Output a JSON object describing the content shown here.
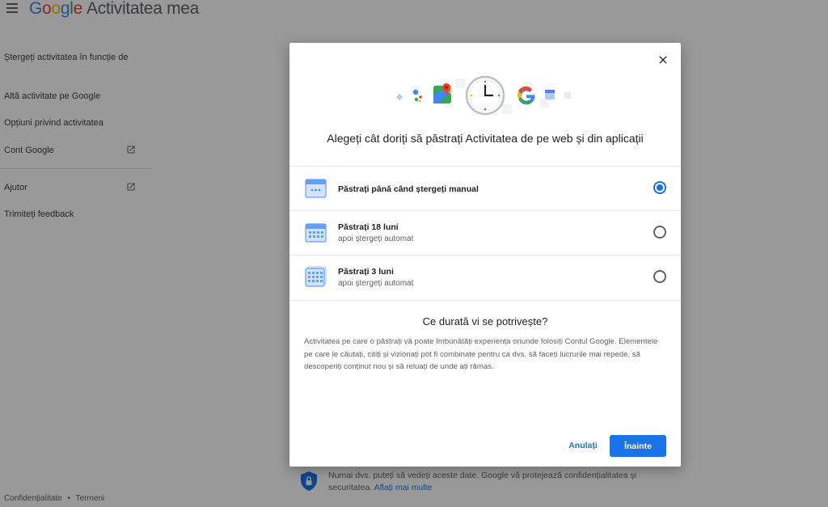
{
  "header": {
    "brand_letters": [
      "G",
      "o",
      "o",
      "g",
      "l",
      "e"
    ],
    "product": "Activitatea mea"
  },
  "sidebar": {
    "items": [
      {
        "label": "Ștergeți activitatea în funcție de"
      },
      {
        "label": "Altă activitate pe Google"
      },
      {
        "label": "Opțiuni privind activitatea"
      },
      {
        "label": "Cont Google"
      },
      {
        "label": "Ajutor"
      },
      {
        "label": "Trimiteți feedback"
      }
    ],
    "footer": {
      "privacy": "Confidențialitate",
      "separator": "•",
      "terms": "Termeni"
    }
  },
  "privacy_note": {
    "text": "Numai dvs. puteți să vedeți aceste date. Google vă protejează confidențialitatea și securitatea.",
    "link": "Aflați mai multe"
  },
  "dialog": {
    "title": "Alegeți cât doriți să păstrați Activitatea de pe web și din aplicații",
    "options": [
      {
        "label": "Păstrați până când ștergeți manual",
        "sub": "",
        "selected": true
      },
      {
        "label": "Păstrați 18 luni",
        "sub": "apoi ștergeți automat",
        "selected": false
      },
      {
        "label": "Păstrați 3 luni",
        "sub": "apoi ștergeți automat",
        "selected": false
      }
    ],
    "question_title": "Ce durată vi se potrivește?",
    "question_body": "Activitatea pe care o păstrați vă poate îmbunătăți experiența oriunde folosiți Contul Google. Elementele pe care le căutați, citiți și vizionați pot fi combinate pentru ca dvs. să faceți lucrurile mai repede, să descoperiți conținut nou și să reluați de unde ați rămas.",
    "cancel_label": "Anulați",
    "next_label": "Înainte"
  },
  "colors": {
    "accent": "#1a73e8",
    "google_blue": "#4285f4",
    "google_red": "#ea4335",
    "google_yellow": "#fbbc05",
    "google_green": "#34a853"
  },
  "icons": {
    "menu": "hamburger-icon",
    "external": "open-in-new-icon",
    "close": "close-icon",
    "shield": "shield-lock-icon",
    "calendar": "calendar-icon",
    "clock": "clock-icon"
  }
}
